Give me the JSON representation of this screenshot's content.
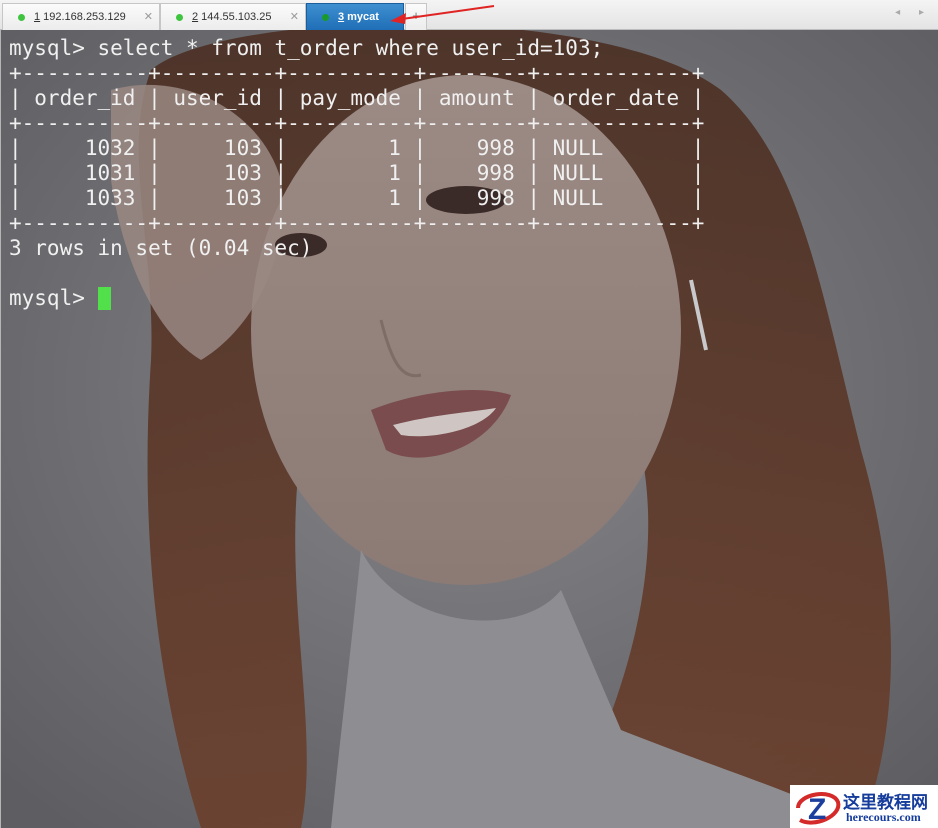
{
  "tabs": [
    {
      "num": "1",
      "label": "192.168.253.129",
      "active": false,
      "status_color": "#3fc43f"
    },
    {
      "num": "2",
      "label": "144.55.103.25",
      "active": false,
      "status_color": "#3fc43f"
    },
    {
      "num": "3",
      "label": "mycat",
      "active": true,
      "status_color": "#1a9a2a"
    }
  ],
  "tab_add_label": "+",
  "tab_close_icon": "close-icon",
  "tab_scroll_icons": "◂ ▸",
  "terminal": {
    "lines": [
      "mysql> select * from t_order where user_id=103;",
      "+----------+---------+----------+--------+------------+",
      "| order_id | user_id | pay_mode | amount | order_date |",
      "+----------+---------+----------+--------+------------+",
      "|     1032 |     103 |        1 |    998 | NULL       |",
      "|     1031 |     103 |        1 |    998 | NULL       |",
      "|     1033 |     103 |        1 |    998 | NULL       |",
      "+----------+---------+----------+--------+------------+",
      "3 rows in set (0.04 sec)",
      ""
    ],
    "prompt": "mysql>",
    "cursor_color": "#52e04a",
    "text_color": "#f0f0f0"
  },
  "watermark": {
    "logo_cn": "这里教程网",
    "logo_en": "herecours.com"
  }
}
